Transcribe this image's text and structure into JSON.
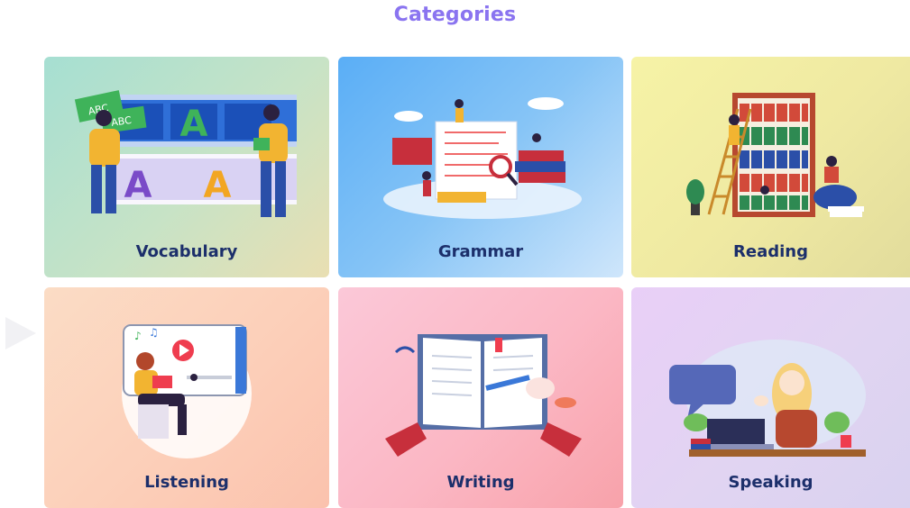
{
  "title": "Categories",
  "cards": [
    {
      "label": "Vocabulary",
      "icon": "vocabulary-illustration-icon"
    },
    {
      "label": "Grammar",
      "icon": "grammar-illustration-icon"
    },
    {
      "label": "Reading",
      "icon": "reading-illustration-icon"
    },
    {
      "label": "Listening",
      "icon": "listening-illustration-icon"
    },
    {
      "label": "Writing",
      "icon": "writing-illustration-icon"
    },
    {
      "label": "Speaking",
      "icon": "speaking-illustration-icon"
    }
  ],
  "vocab_art": {
    "letter": "A",
    "sign1": "ABC",
    "sign2": "ABC"
  },
  "colors": {
    "title": "#8a74f0",
    "label": "#1c2f6b"
  }
}
